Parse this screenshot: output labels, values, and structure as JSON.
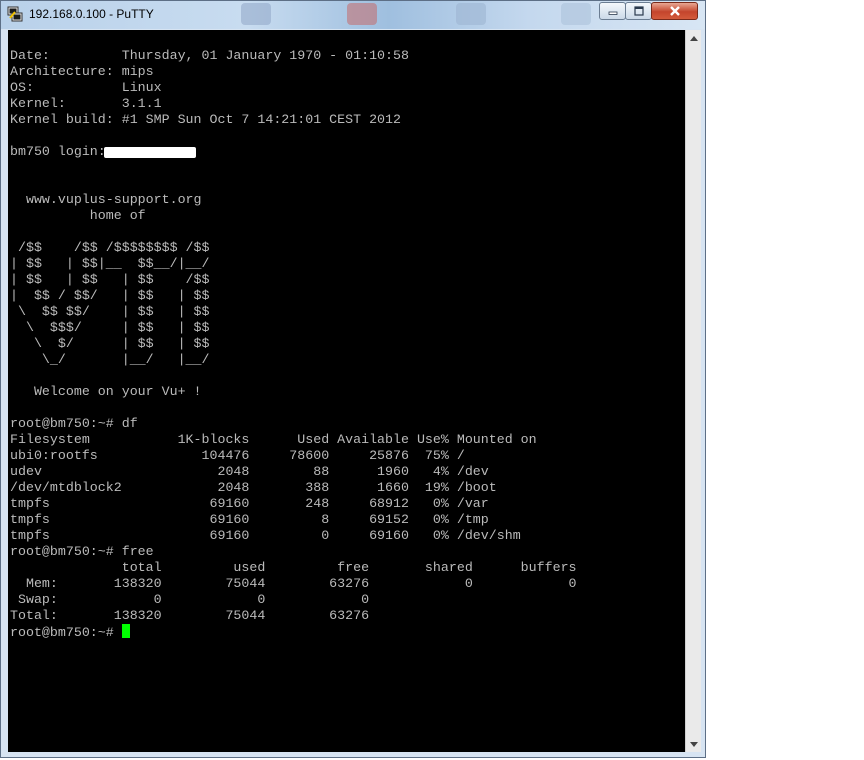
{
  "window": {
    "title": "192.168.0.100 - PuTTY"
  },
  "icons": {
    "app": "putty-icon",
    "minimize": "minimize-icon",
    "maximize": "maximize-icon",
    "close": "close-icon",
    "scroll_up": "scroll-up-arrow-icon",
    "scroll_down": "scroll-down-arrow-icon"
  },
  "colors": {
    "terminal_bg": "#000000",
    "terminal_fg": "#bbbbbb",
    "cursor": "#00ff00"
  },
  "terminal": {
    "lines": [
      "Date:         Thursday, 01 January 1970 - 01:10:58",
      "Architecture: mips",
      "OS:           Linux",
      "Kernel:       3.1.1",
      "Kernel build: #1 SMP Sun Oct 7 14:21:01 CEST 2012",
      "",
      "bm750 login:",
      "",
      "",
      "  www.vuplus-support.org",
      "          home of",
      "",
      " /$$    /$$ /$$$$$$$$ /$$",
      "| $$   | $$|__  $$__/|__/",
      "| $$   | $$   | $$    /$$",
      "|  $$ / $$/   | $$   | $$",
      " \\  $$ $$/    | $$   | $$",
      "  \\  $$$/     | $$   | $$",
      "   \\  $/      | $$   | $$",
      "    \\_/       |__/   |__/",
      "",
      "   Welcome on your Vu+ !",
      "",
      "root@bm750:~# df",
      "Filesystem           1K-blocks      Used Available Use% Mounted on",
      "ubi0:rootfs             104476     78600     25876  75% /",
      "udev                      2048        88      1960   4% /dev",
      "/dev/mtdblock2            2048       388      1660  19% /boot",
      "tmpfs                    69160       248     68912   0% /var",
      "tmpfs                    69160         8     69152   0% /tmp",
      "tmpfs                    69160         0     69160   0% /dev/shm",
      "root@bm750:~# free",
      "              total         used         free       shared      buffers",
      "  Mem:       138320        75044        63276            0            0",
      " Swap:            0            0            0",
      "Total:       138320        75044        63276"
    ],
    "prompt": "root@bm750:~# "
  }
}
